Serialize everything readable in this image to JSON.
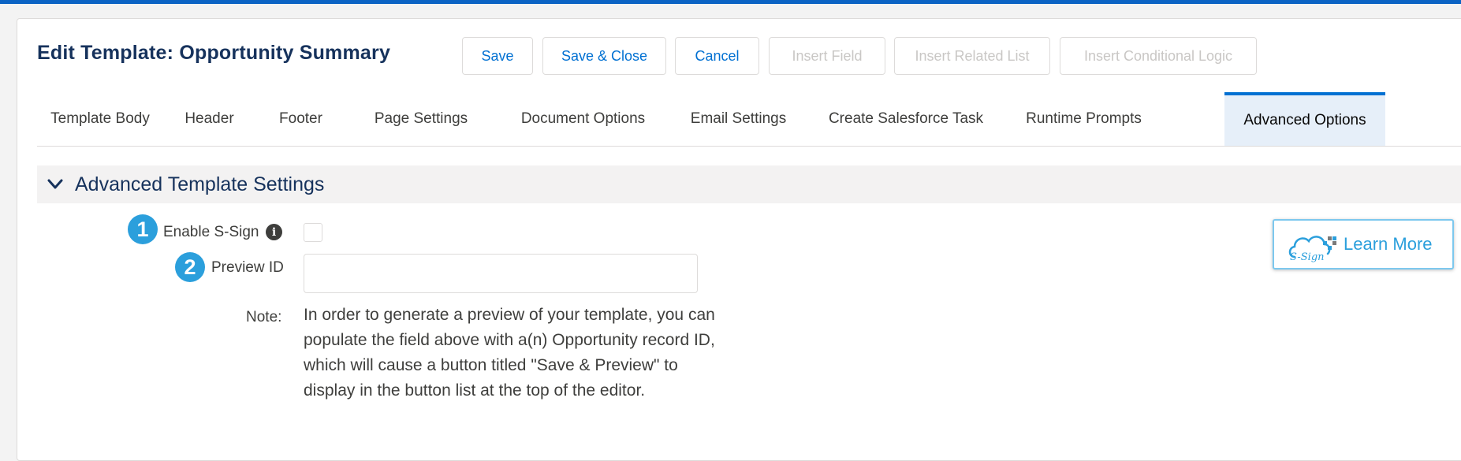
{
  "page": {
    "title": "Edit Template: Opportunity Summary"
  },
  "toolbar": {
    "save_label": "Save",
    "save_close_label": "Save & Close",
    "cancel_label": "Cancel",
    "insert_field_label": "Insert Field",
    "insert_related_list_label": "Insert Related List",
    "insert_conditional_logic_label": "Insert Conditional Logic"
  },
  "tabs": [
    {
      "label": "Template Body",
      "active": false
    },
    {
      "label": "Header",
      "active": false
    },
    {
      "label": "Footer",
      "active": false
    },
    {
      "label": "Page Settings",
      "active": false
    },
    {
      "label": "Document Options",
      "active": false
    },
    {
      "label": "Email Settings",
      "active": false
    },
    {
      "label": "Create Salesforce Task",
      "active": false
    },
    {
      "label": "Runtime Prompts",
      "active": false
    },
    {
      "label": "Advanced Options",
      "active": true
    }
  ],
  "section": {
    "title": "Advanced Template Settings",
    "icon": "chevron-down-icon"
  },
  "fields": {
    "enable_ssign": {
      "step": "1",
      "label": "Enable S-Sign",
      "checked": false,
      "info_glyph": "i"
    },
    "preview_id": {
      "step": "2",
      "label": "Preview ID",
      "value": ""
    }
  },
  "note": {
    "label": "Note:",
    "text": "In order to generate a preview of your template, you can populate the field above with a(n) Opportunity record ID, which will cause a button titled \"Save & Preview\" to display in the button list at the top of the editor."
  },
  "learn_more": {
    "label": "Learn More",
    "logo_text": "S-Sign"
  },
  "colors": {
    "accent": "#0070d2",
    "topbar": "#0b63c4",
    "badge": "#2b9fdc",
    "disabled_text": "#c9c7c5",
    "title_text": "#16325c"
  }
}
